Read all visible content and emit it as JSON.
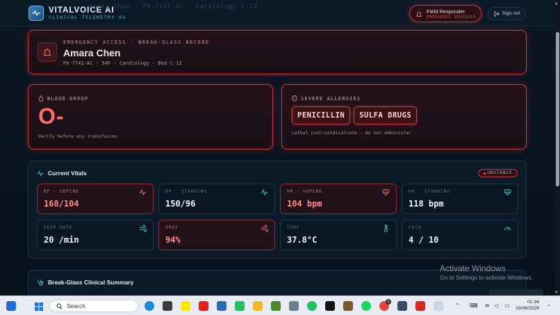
{
  "app": {
    "brand_name": "VITALVOICE AI",
    "brand_tagline": "CLINICAL TELEMETRY OS",
    "window_title": "Amara Chen · PX-7741-AC · Cardiology C-12"
  },
  "topbar": {
    "role_label": "Field Responder",
    "role_sub": "EMERGENCY SERVICES",
    "signout_label": "Sign out"
  },
  "patient": {
    "eyebrow": "EMERGENCY ACCESS · BREAK-GLASS RECORD",
    "name": "Amara Chen",
    "meta": "PX-7741-AC · 54F · Cardiology · Bed C-12"
  },
  "blood": {
    "label": "BLOOD GROUP",
    "value": "O-",
    "note": "Verify before any transfusion"
  },
  "allergies": {
    "label": "SEVERE ALLERGIES",
    "items": [
      "PENICILLIN",
      "SULFA DRUGS"
    ],
    "note": "Lethal contraindications — do not administer"
  },
  "vitals": {
    "title": "Current Vitals",
    "status": "UNSTABLE",
    "tiles": [
      {
        "label": "BP · SUPINE",
        "value": "168/104",
        "alert": true,
        "icon": "pulse-icon"
      },
      {
        "label": "BP · STANDING",
        "value": "150/96",
        "alert": false,
        "icon": "pulse-icon"
      },
      {
        "label": "HR · SUPINE",
        "value": "104 bpm",
        "alert": true,
        "icon": "heart-icon"
      },
      {
        "label": "HR · STANDING",
        "value": "118 bpm",
        "alert": false,
        "icon": "heart-icon"
      },
      {
        "label": "RESP RATE",
        "value": "20 /min",
        "alert": false,
        "icon": "wind-icon"
      },
      {
        "label": "SPO2",
        "value": "94%",
        "alert": true,
        "icon": "wind-icon"
      },
      {
        "label": "TEMP",
        "value": "37.8°C",
        "alert": false,
        "icon": "thermometer-icon"
      },
      {
        "label": "PAIN",
        "value": "4 / 10",
        "alert": false,
        "icon": "gauge-icon"
      }
    ]
  },
  "summary": {
    "title": "Break-Glass Clinical Summary"
  },
  "watermark": {
    "line1": "Activate Windows",
    "line2": "Go to Settings to activate Windows."
  },
  "taskbar": {
    "search_placeholder": "Search",
    "time": "01:34",
    "date": "19/06/2026",
    "badge_count": "1"
  },
  "colors": {
    "alert": "#ff6b6b",
    "accent_teal": "#4cc3c9",
    "panel_bg": "#0c1a28"
  }
}
